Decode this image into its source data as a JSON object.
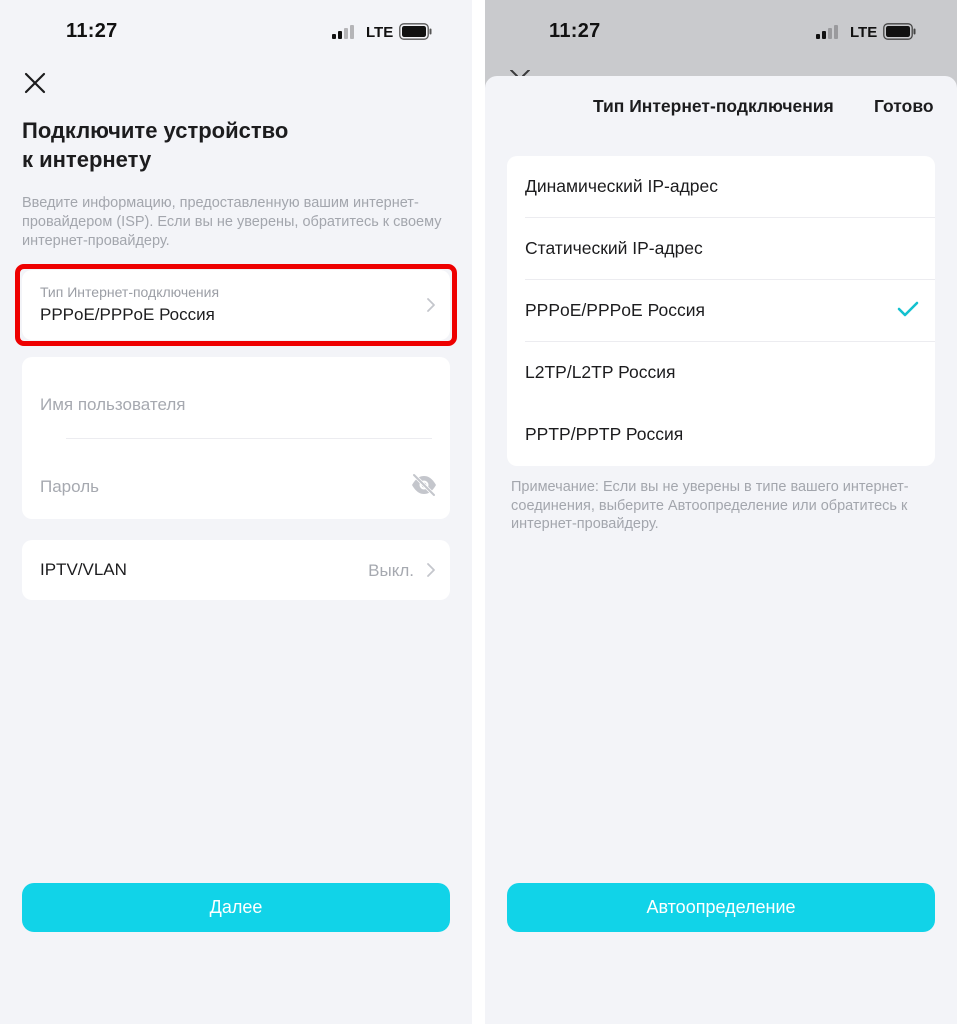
{
  "left_screen": {
    "status_bar": {
      "time": "11:27",
      "network": "LTE"
    },
    "title_line1": "Подключите устройство",
    "title_line2": "к интернету",
    "description": "Введите информацию, предоставленную вашим интернет-провайдером (ISP). Если вы не уверены, обратитесь к своему интернет-провайдеру.",
    "connection_type": {
      "label": "Тип Интернет-подключения",
      "value": "PPPoE/PPPoE Россия"
    },
    "username": {
      "placeholder": "Имя пользователя"
    },
    "password": {
      "placeholder": "Пароль"
    },
    "iptv": {
      "label": "IPTV/VLAN",
      "value": "Выкл."
    },
    "next_button": "Далее"
  },
  "right_screen": {
    "status_bar": {
      "time": "11:27",
      "network": "LTE"
    },
    "sheet_title": "Тип Интернет-подключения",
    "done_label": "Готово",
    "options": [
      {
        "label": "Динамический IP-адрес",
        "selected": false
      },
      {
        "label": "Статический IP-адрес",
        "selected": false
      },
      {
        "label": "PPPoE/PPPoE Россия",
        "selected": true
      },
      {
        "label": "L2TP/L2TP Россия",
        "selected": false
      },
      {
        "label": "PPTP/PPTP Россия",
        "selected": false
      }
    ],
    "note": "Примечание: Если вы не уверены в типе вашего интернет-соединения, выберите Автоопределение или обратитесь к интернет-провайдеру.",
    "auto_button": "Автоопределение"
  },
  "icons": {
    "close": "close-icon",
    "chevron": "chevron-right-icon",
    "eye_hidden": "eye-off-icon",
    "check": "checkmark-icon",
    "signal": "signal-icon",
    "battery": "battery-icon"
  },
  "colors": {
    "accent": "#11d3e8",
    "check": "#13c1cf",
    "highlight": "#ee0000",
    "background": "#f3f4f8",
    "overlay": "#c9cacd"
  }
}
